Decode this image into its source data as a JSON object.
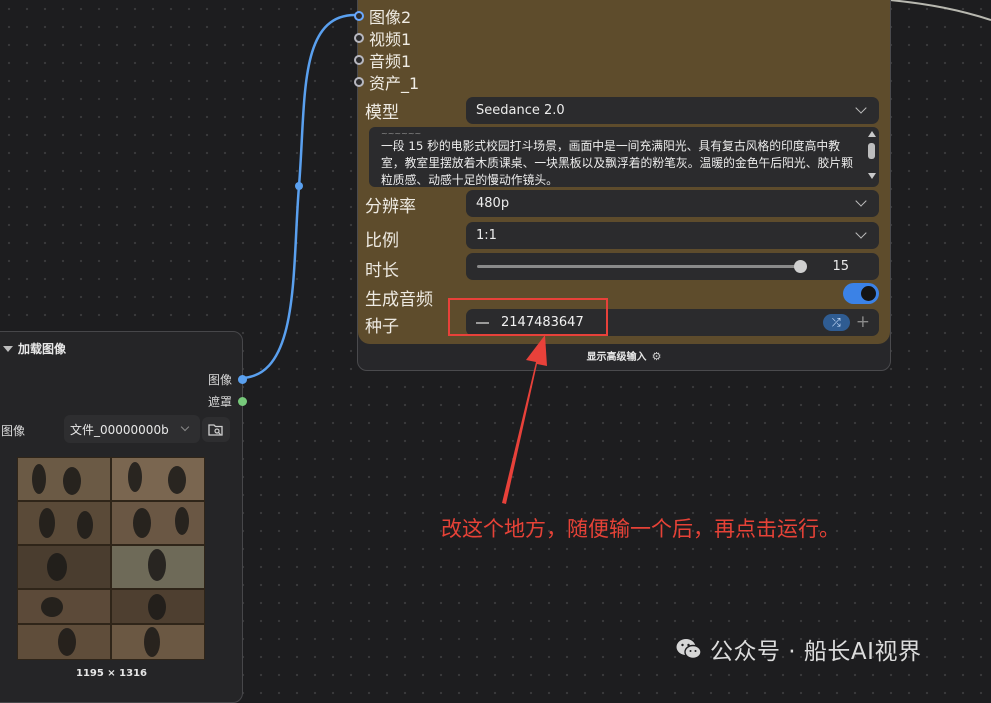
{
  "seedance_node": {
    "inputs": [
      {
        "label": "图像2",
        "connected": true
      },
      {
        "label": "视频1",
        "connected": false
      },
      {
        "label": "音频1",
        "connected": false
      },
      {
        "label": "资产_1",
        "connected": false
      }
    ],
    "model": {
      "label": "模型",
      "value": "Seedance 2.0"
    },
    "prompt": {
      "faded_text": "~~~~~~",
      "text": "一段 15 秒的电影式校园打斗场景，画面中是一间充满阳光、具有复古风格的印度高中教室，教室里摆放着木质课桌、一块黑板以及飘浮着的粉笔灰。温暖的金色午后阳光、胶片颗粒质感、动感十足的慢动作镜头。"
    },
    "resolution": {
      "label": "分辨率",
      "value": "480p"
    },
    "ratio": {
      "label": "比例",
      "value": "1:1"
    },
    "duration": {
      "label": "时长",
      "value": "15",
      "fraction": 0.97
    },
    "generate_audio": {
      "label": "生成音频",
      "enabled": true
    },
    "seed": {
      "label": "种子",
      "value": "2147483647"
    },
    "advanced_label": "显示高级输入"
  },
  "load_image_node": {
    "title": "加载图像",
    "outputs": [
      {
        "label": "图像",
        "color": "#5aa0ef"
      },
      {
        "label": "遮罩",
        "color": "#77c97b"
      }
    ],
    "image_label": "图像",
    "file_value": "文件_00000000b",
    "dimensions": "1195 × 1316"
  },
  "annotation": {
    "text": "改这个地方，随便输一个后，再点击运行。",
    "color": "#e64237"
  },
  "watermark": {
    "text": "公众号 · 船长AI视界"
  },
  "colors": {
    "canvas_bg": "#1d1d1f",
    "node_body": "#5e4c2c",
    "wire": "#5aa0ef",
    "accent_toggle": "#3b82e6",
    "highlight": "#e8413a"
  }
}
